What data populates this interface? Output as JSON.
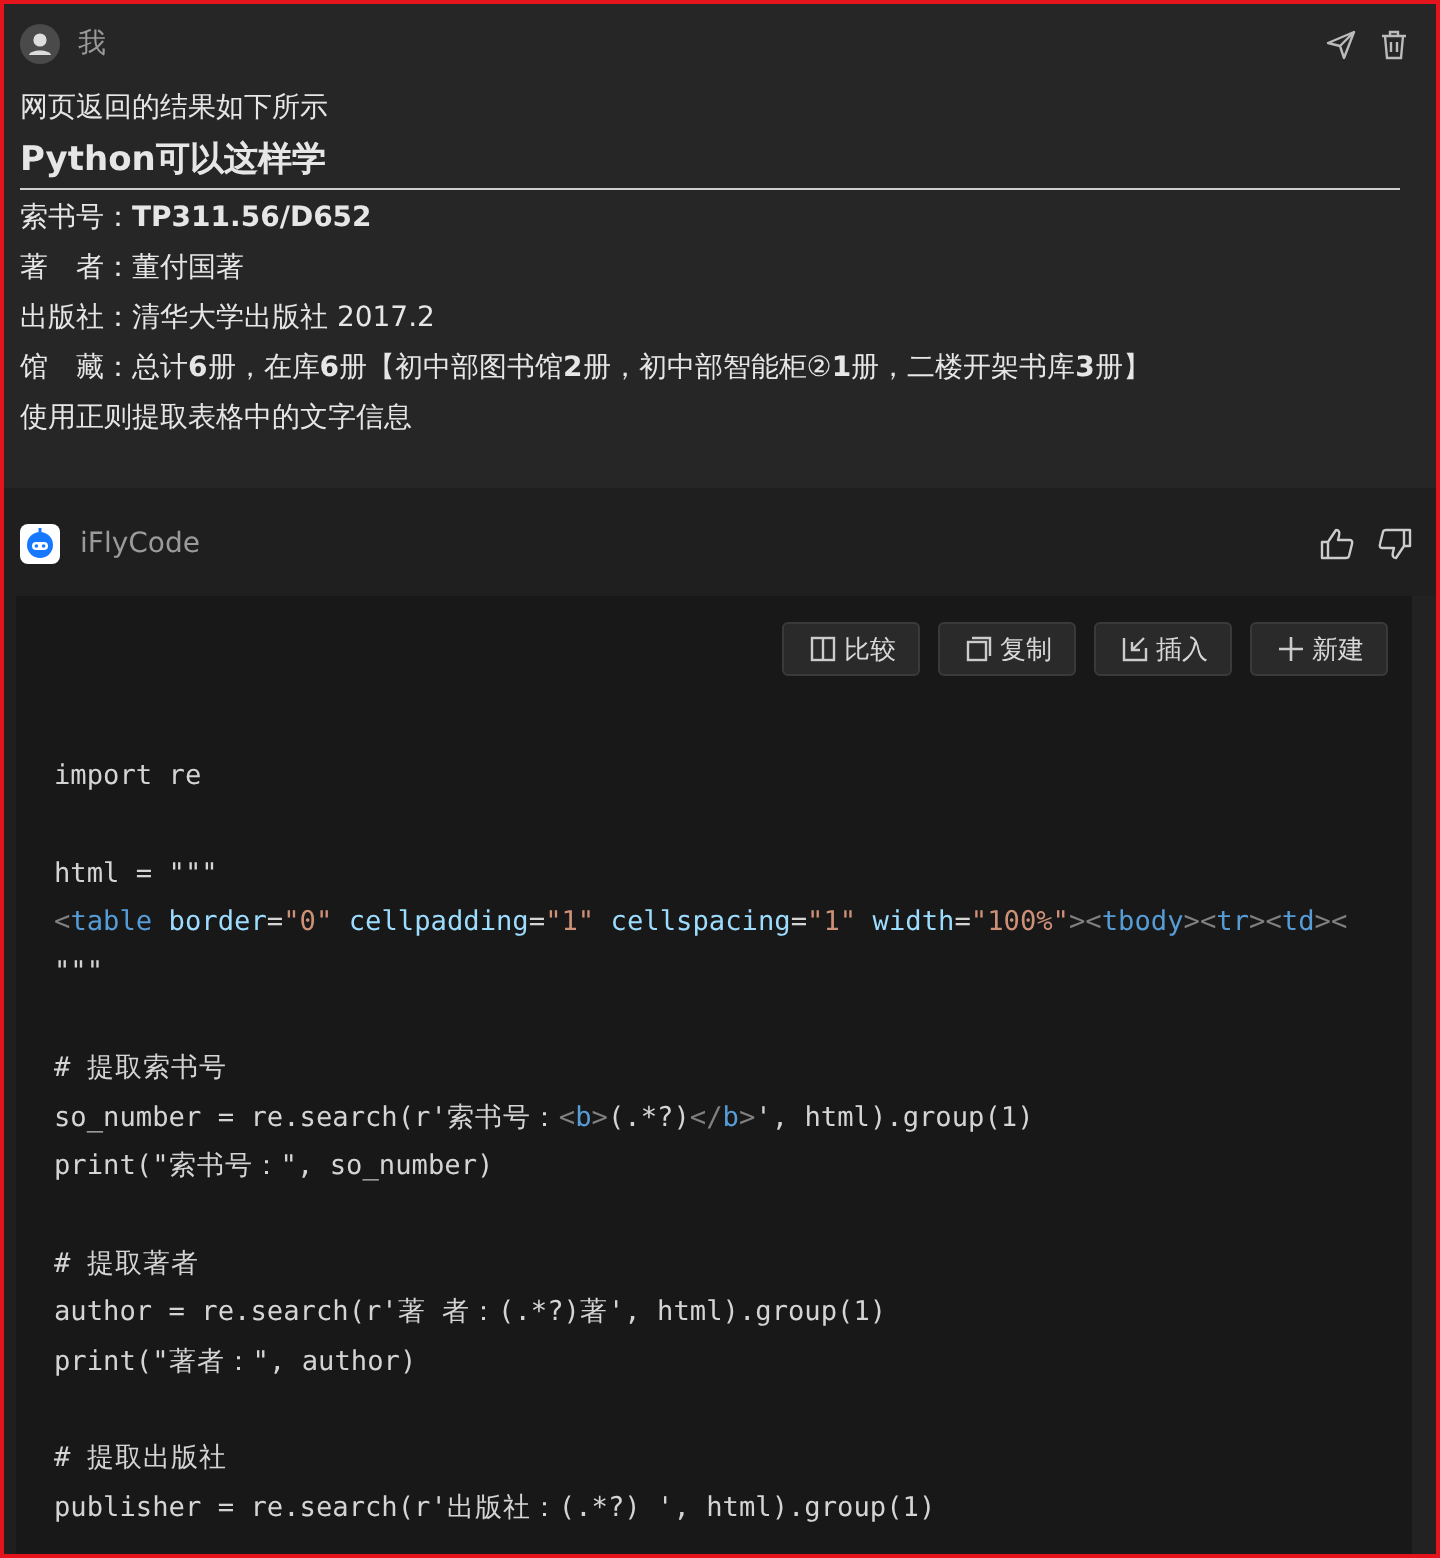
{
  "user": {
    "name": "我"
  },
  "message": {
    "intro": "网页返回的结果如下所示",
    "title": "Python可以这样学",
    "fields": [
      "索书号：**TP311.56/D652**",
      "著　者：董付国著",
      "出版社：清华大学出版社 2017.2",
      "馆　藏：总计**6**册，在库**6**册【初中部图书馆**2**册，初中部智能柜②**1**册，二楼开架书库**3**册】"
    ],
    "request": "使用正则提取表格中的文字信息"
  },
  "assistant": {
    "name": "iFlyCode"
  },
  "code_toolbar": {
    "buttons": [
      {
        "label": "比较",
        "kind": "compare"
      },
      {
        "label": "复制",
        "kind": "copy"
      },
      {
        "label": "插入",
        "kind": "insert"
      },
      {
        "label": "新建",
        "kind": "new"
      }
    ]
  },
  "code": {
    "lines": [
      {
        "kind": "code",
        "tokens": [
          {
            "text": "import re",
            "kind": "plain"
          }
        ]
      },
      {
        "kind": "blank"
      },
      {
        "kind": "code",
        "tokens": [
          {
            "text": "html = \"\"\"",
            "kind": "plain"
          }
        ]
      },
      {
        "kind": "code",
        "tokens": [
          {
            "text": "<",
            "kind": "punct"
          },
          {
            "text": "table",
            "kind": "tag"
          },
          {
            "text": " border",
            "kind": "attr"
          },
          {
            "text": "=",
            "kind": "plain"
          },
          {
            "text": "\"0\"",
            "kind": "string"
          },
          {
            "text": " cellpadding",
            "kind": "attr"
          },
          {
            "text": "=",
            "kind": "plain"
          },
          {
            "text": "\"1\"",
            "kind": "string"
          },
          {
            "text": " cellspacing",
            "kind": "attr"
          },
          {
            "text": "=",
            "kind": "plain"
          },
          {
            "text": "\"1\"",
            "kind": "string"
          },
          {
            "text": " width",
            "kind": "attr"
          },
          {
            "text": "=",
            "kind": "plain"
          },
          {
            "text": "\"100%\"",
            "kind": "string"
          },
          {
            "text": "><",
            "kind": "punct"
          },
          {
            "text": "tbody",
            "kind": "tag"
          },
          {
            "text": "><",
            "kind": "punct"
          },
          {
            "text": "tr",
            "kind": "tag"
          },
          {
            "text": "><",
            "kind": "punct"
          },
          {
            "text": "td",
            "kind": "tag"
          },
          {
            "text": "><",
            "kind": "punct"
          }
        ]
      },
      {
        "kind": "code",
        "tokens": [
          {
            "text": "\"\"\"",
            "kind": "plain"
          }
        ]
      },
      {
        "kind": "blank"
      },
      {
        "kind": "code",
        "tokens": [
          {
            "text": "# 提取索书号",
            "kind": "plain"
          }
        ]
      },
      {
        "kind": "code",
        "tokens": [
          {
            "text": "so_number = re.search(r'索书号：",
            "kind": "plain"
          },
          {
            "text": "<",
            "kind": "punct"
          },
          {
            "text": "b",
            "kind": "tag"
          },
          {
            "text": ">",
            "kind": "punct"
          },
          {
            "text": "(.*?)",
            "kind": "plain"
          },
          {
            "text": "</",
            "kind": "punct"
          },
          {
            "text": "b",
            "kind": "tag"
          },
          {
            "text": ">",
            "kind": "punct"
          },
          {
            "text": "', html).group(1)",
            "kind": "plain"
          }
        ]
      },
      {
        "kind": "code",
        "tokens": [
          {
            "text": "print(\"索书号：\", so_number)",
            "kind": "plain"
          }
        ]
      },
      {
        "kind": "blank"
      },
      {
        "kind": "code",
        "tokens": [
          {
            "text": "# 提取著者",
            "kind": "plain"
          }
        ]
      },
      {
        "kind": "code",
        "tokens": [
          {
            "text": "author = re.search(r'著 者：(.*?)著', html).group(1)",
            "kind": "plain"
          }
        ]
      },
      {
        "kind": "code",
        "tokens": [
          {
            "text": "print(\"著者：\", author)",
            "kind": "plain"
          }
        ]
      },
      {
        "kind": "blank"
      },
      {
        "kind": "code",
        "tokens": [
          {
            "text": "# 提取出版社",
            "kind": "plain"
          }
        ]
      },
      {
        "kind": "code",
        "tokens": [
          {
            "text": "publisher = re.search(r'出版社：(.*?) ', html).group(1)",
            "kind": "plain"
          }
        ]
      }
    ]
  }
}
